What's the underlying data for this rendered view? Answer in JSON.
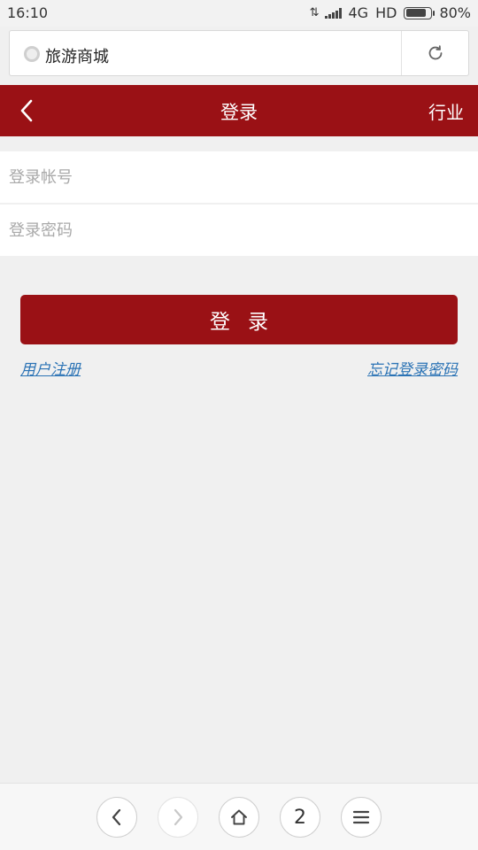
{
  "status_bar": {
    "time": "16:10",
    "network": "4G",
    "hd": "HD",
    "battery": "80%",
    "battery_level": 0.8
  },
  "browser": {
    "address_title": "旅游商城",
    "tab_count": "2"
  },
  "header": {
    "title": "登录",
    "right_label": "行业"
  },
  "form": {
    "account_placeholder": "登录帐号",
    "password_placeholder": "登录密码",
    "login_button": "登录"
  },
  "links": {
    "register": "用户注册",
    "forgot_password": "忘记登录密码"
  },
  "colors": {
    "brand_red": "#9a1115",
    "link_blue": "#2b73b5",
    "background": "#f0f0f0"
  },
  "icons": {
    "back": "chevron-left-icon",
    "refresh": "refresh-icon",
    "nav_back": "chevron-left-icon",
    "nav_forward": "chevron-right-icon",
    "home": "home-icon",
    "menu": "menu-icon"
  }
}
